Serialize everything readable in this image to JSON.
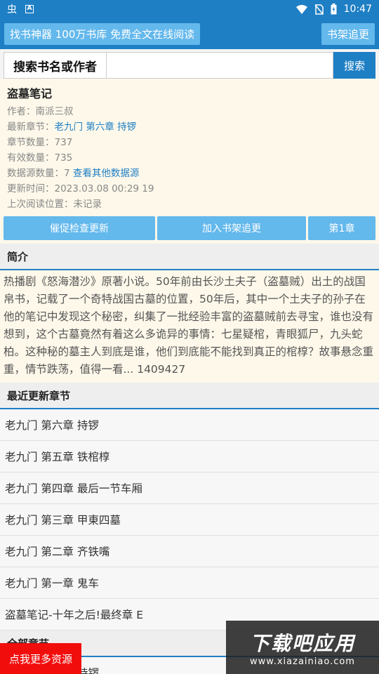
{
  "statusbar": {
    "app_glyph": "虫",
    "badge": "A",
    "time": "10:47"
  },
  "topbar": {
    "left_label": "找书神器 100万书库 免费全文在线阅读",
    "right_label": "书架追更"
  },
  "search": {
    "label": "搜索书名或作者",
    "placeholder": "",
    "button": "搜索"
  },
  "book": {
    "title": "盗墓笔记",
    "author": "作者：南派三叔",
    "latest_label": "最新章节：",
    "latest_value": "老九门 第六章 持锣",
    "chapter_count": "章节数量：737",
    "valid_count": "有效数量：735",
    "source_label": "数据源数量：7",
    "source_link": "查看其他数据源",
    "updated": "更新时间：2023.03.08 00:29 19",
    "last_read": "上次阅读位置：未记录"
  },
  "actions": {
    "urge": "催促检查更新",
    "add": "加入书架追更",
    "first": "第1章"
  },
  "intro": {
    "header": "简介",
    "text": "热播剧《怒海潜沙》原著小说。50年前由长沙土夫子（盗墓贼）出土的战国帛书，记载了一个奇特战国古墓的位置，50年后，其中一个土夫子的孙子在他的笔记中发现这个秘密，纠集了一批经验丰富的盗墓贼前去寻宝，谁也没有想到，这个古墓竟然有着这么多诡异的事情：七星疑棺，青眼狐尸，九头蛇柏。这种秘的墓主人到底是谁，他们到底能不能找到真正的棺椁？故事悬念重重，情节跌荡，值得一看... 1409427"
  },
  "recent": {
    "header": "最近更新章节",
    "items": [
      "老九门 第六章 持锣",
      "老九门 第五章 铁棺椁",
      "老九门 第四章 最后一节车厢",
      "老九门 第三章 甲東四墓",
      "老九门 第二章 齐铁嘴",
      "老九门 第一章 鬼车",
      "盗墓笔记-十年之后!最终章 E"
    ]
  },
  "all": {
    "header": "全部章节",
    "first_item_partial": "持锣"
  },
  "float_button": "点我更多资源",
  "watermark": {
    "big": "下载吧应用",
    "small": "www.xiazainiao.com"
  }
}
